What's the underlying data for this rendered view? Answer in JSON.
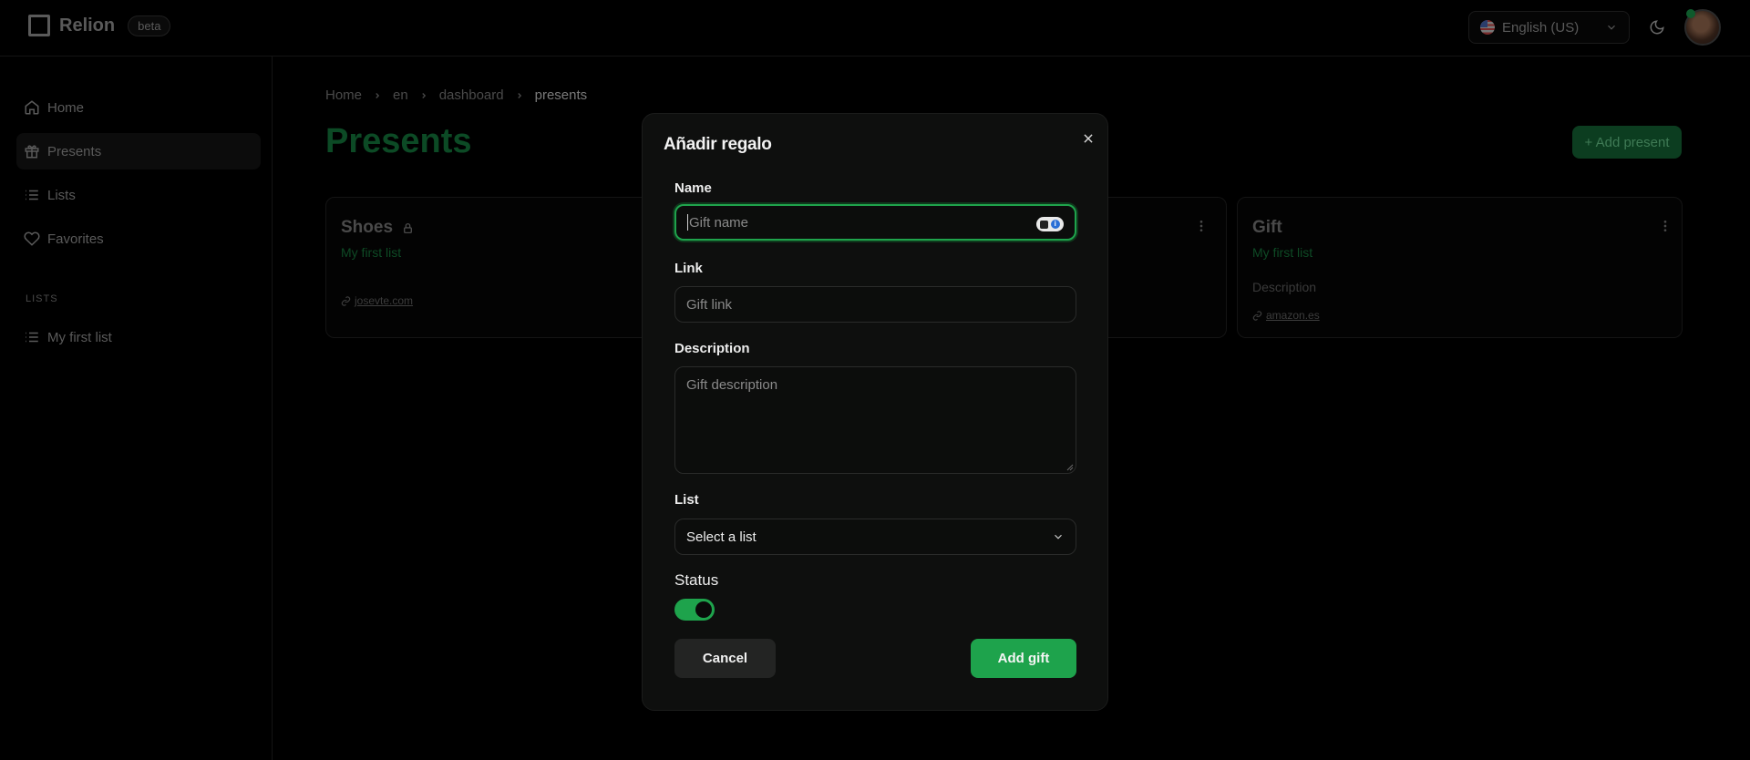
{
  "header": {
    "brand": "Relion",
    "badge": "beta",
    "language": "English (US)"
  },
  "sidebar": {
    "items": [
      {
        "label": "Home",
        "icon": "home-icon"
      },
      {
        "label": "Presents",
        "icon": "gift-icon",
        "active": true
      },
      {
        "label": "Lists",
        "icon": "list-icon"
      },
      {
        "label": "Favorites",
        "icon": "heart-icon"
      }
    ],
    "section_label": "LISTS",
    "lists": [
      {
        "label": "My first list",
        "icon": "list-icon"
      }
    ]
  },
  "breadcrumb": [
    "Home",
    "en",
    "dashboard",
    "presents"
  ],
  "page": {
    "title": "Presents",
    "add_button": "+ Add present"
  },
  "cards": [
    {
      "title": "Shoes",
      "list": "My first list",
      "link": "josevte.com",
      "locked": true
    },
    {
      "title": "",
      "list": "",
      "link": ""
    },
    {
      "title": "Gift",
      "list": "My first list",
      "description": "Description",
      "link": "amazon.es"
    }
  ],
  "modal": {
    "title": "Añadir regalo",
    "name_label": "Name",
    "name_placeholder": "Gift name",
    "link_label": "Link",
    "link_placeholder": "Gift link",
    "description_label": "Description",
    "description_placeholder": "Gift description",
    "list_label": "List",
    "list_value": "Select a list",
    "status_label": "Status",
    "status_on": true,
    "cancel_label": "Cancel",
    "submit_label": "Add gift"
  },
  "colors": {
    "accent": "#1ea34c",
    "background": "#000000",
    "modal_bg": "#0e0f0e"
  }
}
